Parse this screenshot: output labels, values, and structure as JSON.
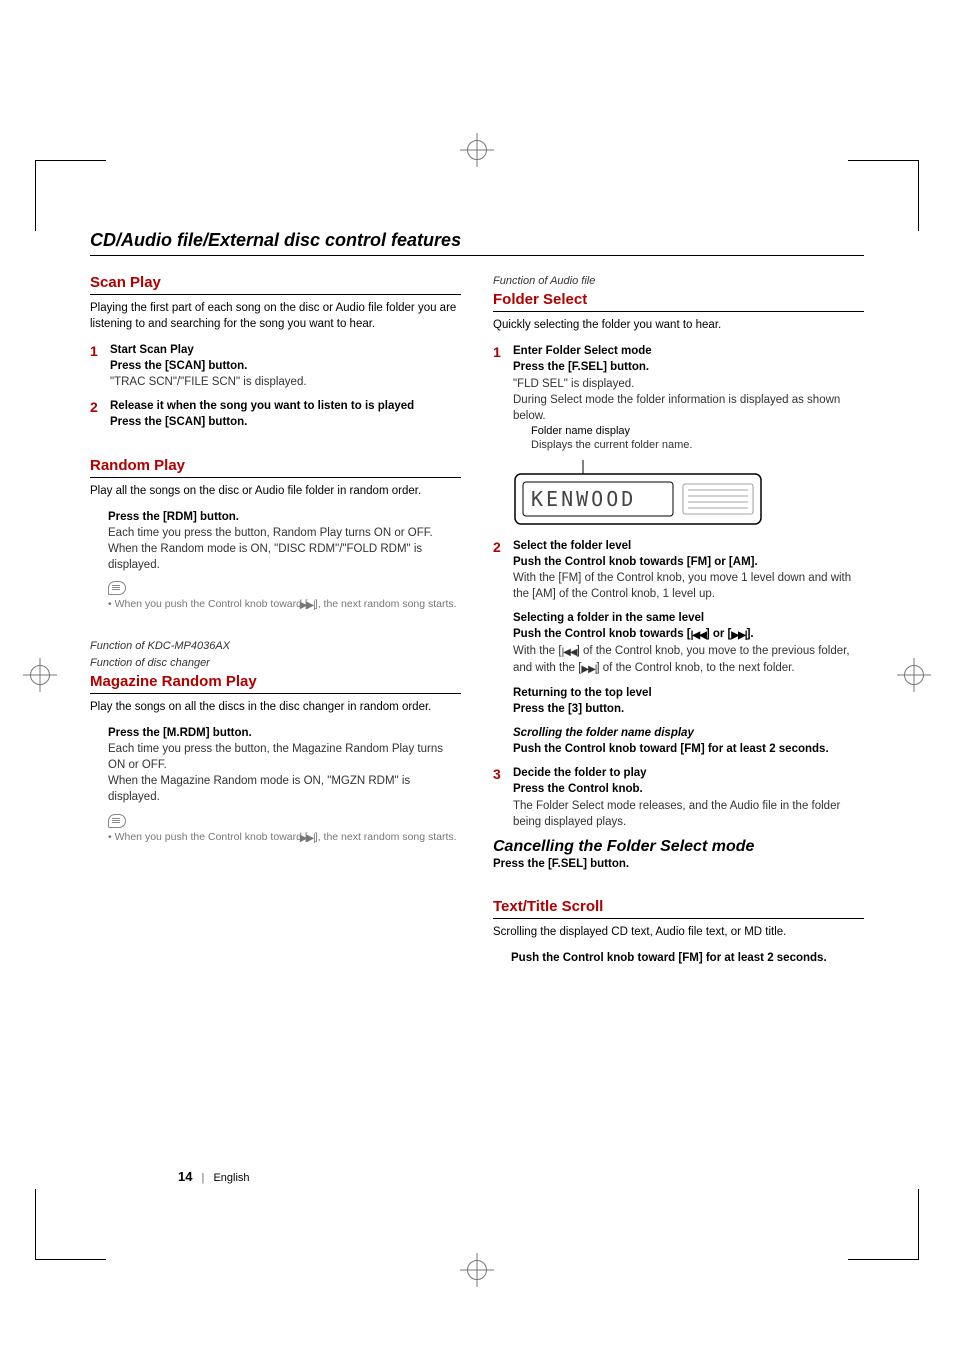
{
  "page": {
    "section_title": "CD/Audio file/External disc control features",
    "page_number": "14",
    "language": "English"
  },
  "left": {
    "scan_play": {
      "heading": "Scan Play",
      "intro": "Playing the first part of each song on the disc or Audio file folder you are listening to and searching for the song you want to hear.",
      "step1_num": "1",
      "step1_title": "Start Scan Play",
      "step1_action": "Press the [SCAN] button.",
      "step1_text": "\"TRAC SCN\"/\"FILE SCN\" is displayed.",
      "step2_num": "2",
      "step2_title": "Release it when the song you want to listen to is played",
      "step2_action": "Press the [SCAN] button."
    },
    "random_play": {
      "heading": "Random Play",
      "intro": "Play all the songs on the disc or Audio file folder in random order.",
      "action": "Press the [RDM] button.",
      "text1": "Each time you press the button, Random Play turns ON or OFF.",
      "text2": "When the Random mode is ON, \"DISC RDM\"/\"FOLD RDM\" is displayed.",
      "note_prefix": "• When you push the Control knob toward [",
      "note_icon_name": "next-track-icon",
      "note_glyph": "▶▶|",
      "note_suffix": "], the next random song starts."
    },
    "magazine_random_play": {
      "func1": "Function of KDC-MP4036AX",
      "func2": "Function of disc changer",
      "heading": "Magazine Random Play",
      "intro": "Play the songs on all the discs in the disc changer in random order.",
      "action": "Press the [M.RDM] button.",
      "text1": "Each time you press the button, the Magazine Random Play turns ON or OFF.",
      "text2": "When the Magazine Random mode is ON, \"MGZN RDM\" is displayed.",
      "note_prefix": "• When you push the Control knob toward [",
      "note_icon_name": "next-track-icon",
      "note_glyph": "▶▶|",
      "note_suffix": "], the next random song starts."
    }
  },
  "right": {
    "folder_select": {
      "func": "Function of Audio file",
      "heading": "Folder Select",
      "intro": "Quickly selecting the folder you want to hear.",
      "step1_num": "1",
      "step1_title": "Enter Folder Select mode",
      "step1_action": "Press the [F.SEL] button.",
      "step1_text1": "\"FLD SEL\" is displayed.",
      "step1_text2": "During Select mode the folder information is displayed as shown below.",
      "folder_label": "Folder name display",
      "folder_label_sub": "Displays the current folder name.",
      "step2_num": "2",
      "step2_title": "Select the folder level",
      "step2_action": "Push the Control knob towards [FM] or [AM].",
      "step2_text": "With the [FM] of the Control knob, you move 1 level down and with the [AM] of the Control knob, 1 level up.",
      "same_level_title": "Selecting a folder in the same level",
      "same_level_action_pre": "Push the Control knob towards [",
      "same_level_icon_prev_name": "prev-track-icon",
      "same_level_icon_prev": "|◀◀",
      "same_level_action_mid": "] or [",
      "same_level_icon_next_name": "next-track-icon",
      "same_level_icon_next": "▶▶|",
      "same_level_action_post": "].",
      "same_level_text_pre": "With the [",
      "same_level_text_icon1_name": "prev-track-icon",
      "same_level_text_icon1": "|◀◀",
      "same_level_text_mid": "] of the Control knob, you move to the previous folder, and with the [",
      "same_level_text_icon2_name": "next-track-icon",
      "same_level_text_icon2": "▶▶|",
      "same_level_text_post": "] of the Control knob, to the next folder.",
      "return_title": "Returning to the top level",
      "return_action": "Press the [3] button.",
      "scroll_title": "Scrolling the folder name display",
      "scroll_action": "Push the Control knob toward [FM] for at least 2 seconds.",
      "step3_num": "3",
      "step3_title": "Decide the folder to play",
      "step3_action": "Press the Control knob.",
      "step3_text": "The Folder Select mode releases, and the Audio file in the folder being displayed plays.",
      "cancel_title": "Cancelling the Folder Select mode",
      "cancel_action": "Press the [F.SEL] button."
    },
    "text_title_scroll": {
      "heading": "Text/Title Scroll",
      "intro": "Scrolling the displayed CD text, Audio file text, or MD title.",
      "action": "Push the Control knob toward [FM] for at least 2 seconds."
    }
  },
  "chart_data": {
    "type": "table",
    "title": "LCD display illustration",
    "display_text": "KENWOOD",
    "right_segment_hint": "signal/level indicator glyphs"
  }
}
